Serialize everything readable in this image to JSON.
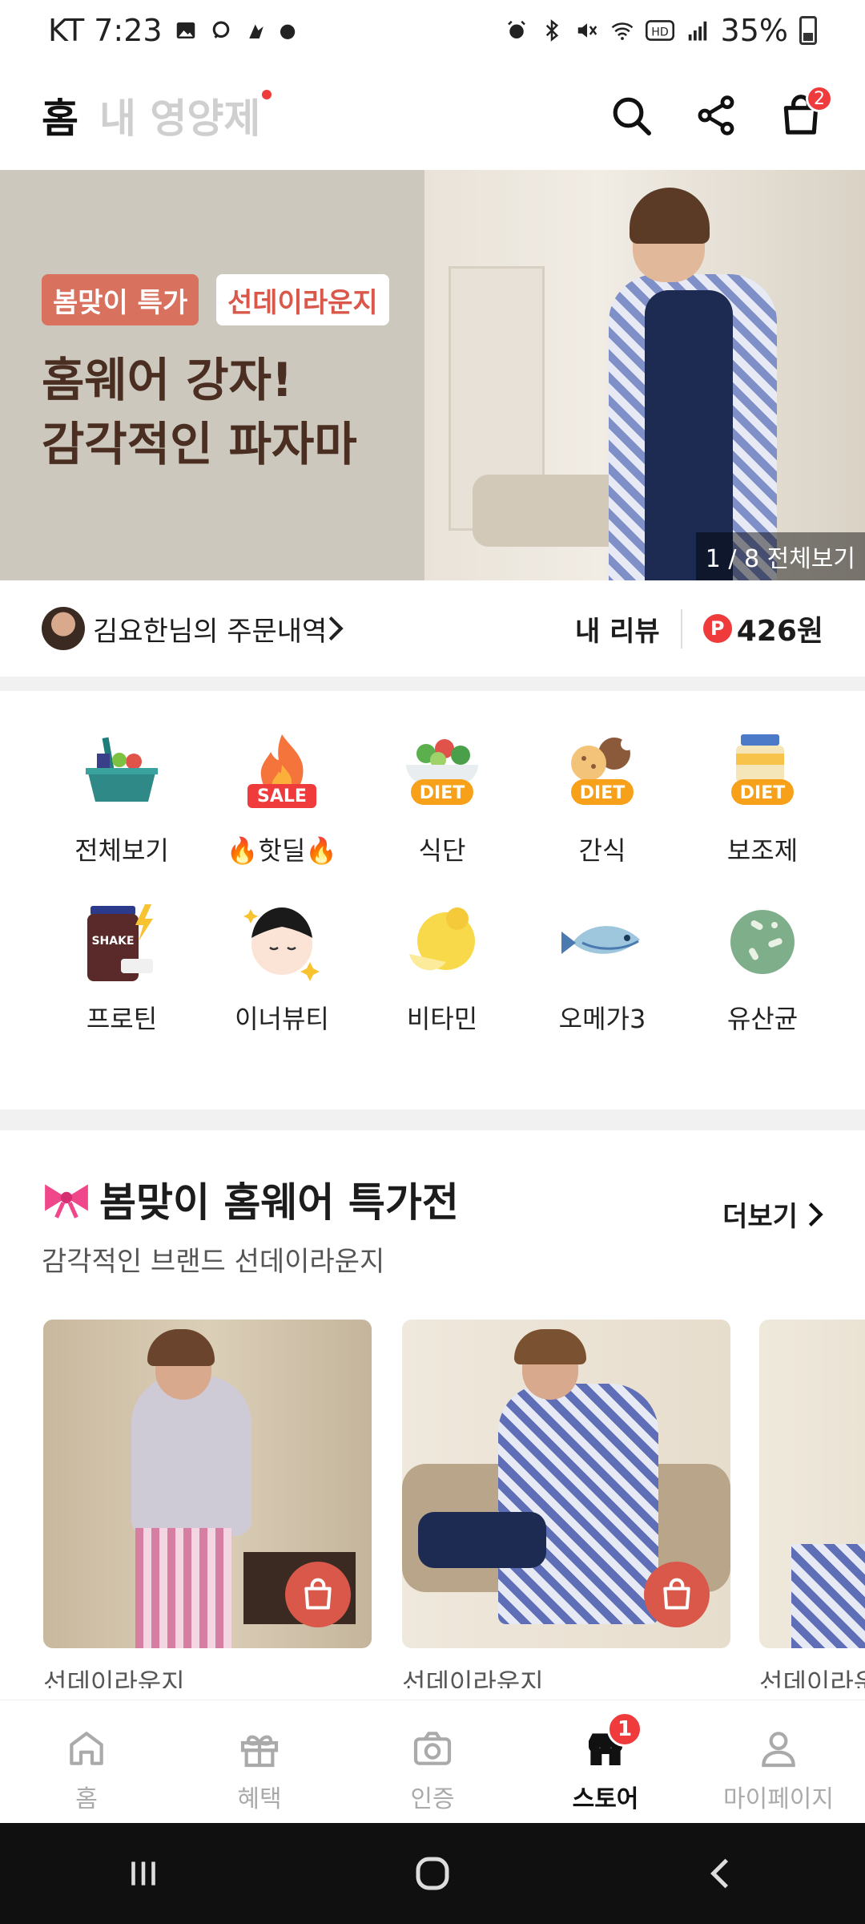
{
  "status": {
    "carrier_time": "KT 7:23",
    "battery": "35%"
  },
  "header": {
    "tab_home": "홈",
    "tab_mine": "내 영양제",
    "cart_count": "2"
  },
  "banner": {
    "tag1": "봄맞이 특가",
    "tag2": "선데이라운지",
    "title_line1": "홈웨어 강자!",
    "title_line2": "감각적인 파자마",
    "pager": "1 / 8 전체보기"
  },
  "order": {
    "text": "김요한님의 주문내역",
    "review": "내 리뷰",
    "points_icon": "P",
    "points": "426원"
  },
  "categories": [
    {
      "label": "전체보기",
      "icon": "basket-icon"
    },
    {
      "label": "🔥핫딜🔥",
      "icon": "fire-sale-icon"
    },
    {
      "label": "식단",
      "icon": "diet-meal-icon"
    },
    {
      "label": "간식",
      "icon": "diet-snack-icon"
    },
    {
      "label": "보조제",
      "icon": "diet-supplement-icon"
    },
    {
      "label": "프로틴",
      "icon": "protein-shake-icon"
    },
    {
      "label": "이너뷰티",
      "icon": "inner-beauty-icon"
    },
    {
      "label": "비타민",
      "icon": "lemon-icon"
    },
    {
      "label": "오메가3",
      "icon": "fish-icon"
    },
    {
      "label": "유산균",
      "icon": "probiotic-icon"
    }
  ],
  "section": {
    "title": "봄맞이 홈웨어 특가전",
    "subtitle": "감각적인 브랜드 선데이라운지",
    "more": "더보기"
  },
  "products": [
    {
      "brand": "선데이라운지"
    },
    {
      "brand": "선데이라운지"
    },
    {
      "brand": "선데이라운"
    }
  ],
  "bottom_nav": [
    {
      "label": "홈"
    },
    {
      "label": "혜택"
    },
    {
      "label": "인증"
    },
    {
      "label": "스토어",
      "badge": "1"
    },
    {
      "label": "마이페이지"
    }
  ],
  "colors": {
    "accent": "#ef3b3b",
    "banner_tag": "#d9715f",
    "banner_text": "#4a2e22"
  }
}
